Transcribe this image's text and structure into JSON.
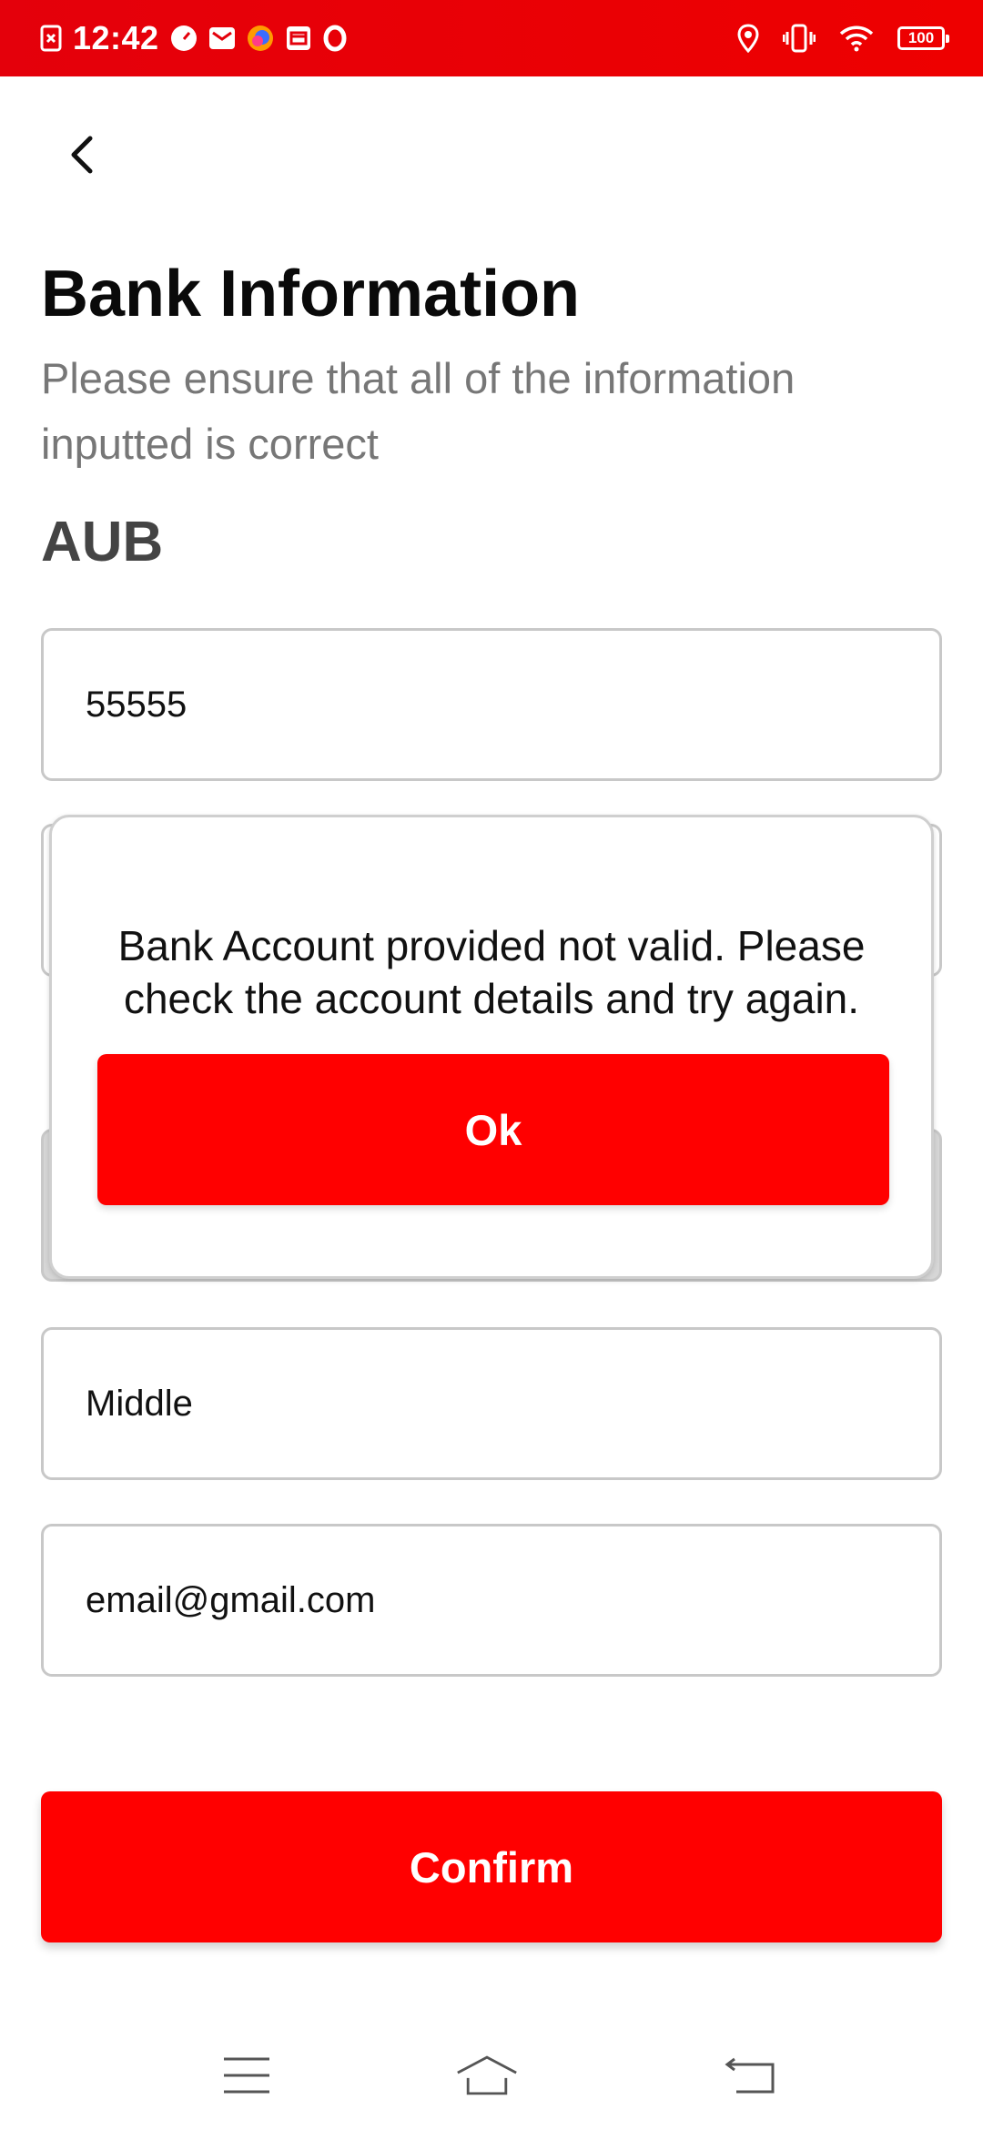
{
  "status_bar": {
    "time": "12:42",
    "battery": "100",
    "left_icons": [
      "screenshot-icon",
      "speedometer-icon",
      "mail-icon",
      "browser-icon",
      "calendar-icon",
      "opera-icon"
    ],
    "right_icons": [
      "location-icon",
      "vibrate-icon",
      "wifi-icon",
      "battery-icon"
    ]
  },
  "header": {
    "title": "Bank Information",
    "subtitle": "Please ensure that all of the information inputted is correct",
    "bank_name": "AUB"
  },
  "form": {
    "account_number": "55555",
    "middle_name": "Middle",
    "email": "email@gmail.com"
  },
  "dialog": {
    "message": "Bank Account provided not valid. Please check the account details and try again.",
    "ok_label": "Ok"
  },
  "actions": {
    "confirm_label": "Confirm"
  },
  "colors": {
    "accent": "#ff0000",
    "status_bar": "#e4000b"
  }
}
